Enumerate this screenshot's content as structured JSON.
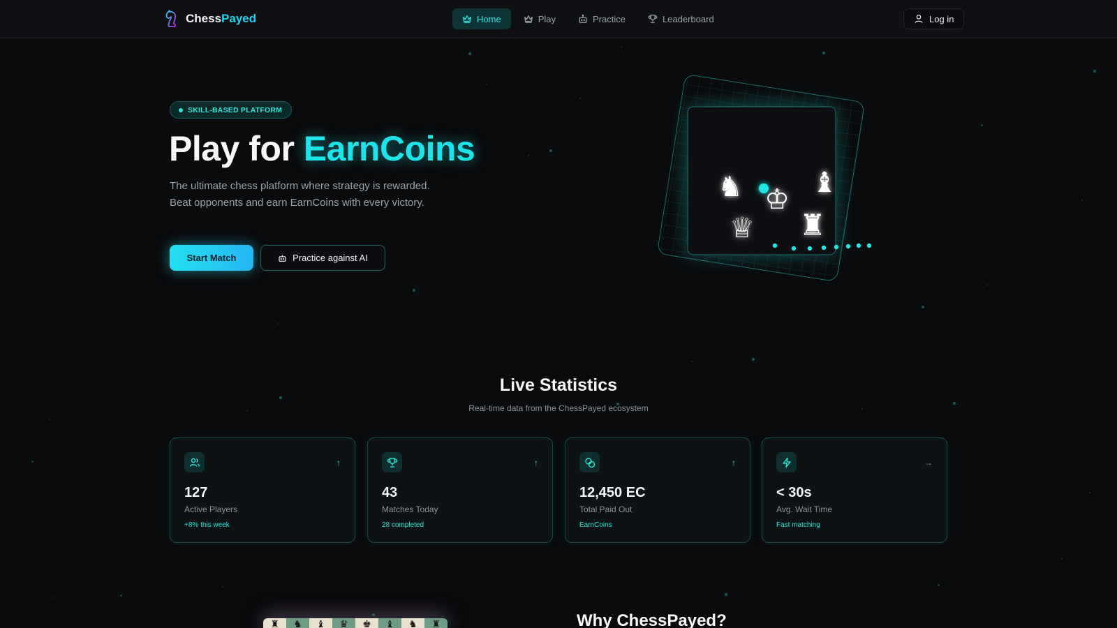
{
  "brand": {
    "name_main": "Chess",
    "name_accent": "Payed"
  },
  "nav": {
    "items": [
      {
        "label": "Home",
        "icon": "crown-icon",
        "active": true
      },
      {
        "label": "Play",
        "icon": "crown-icon",
        "active": false
      },
      {
        "label": "Practice",
        "icon": "bot-icon",
        "active": false
      },
      {
        "label": "Leaderboard",
        "icon": "trophy-icon",
        "active": false
      }
    ],
    "login_label": "Log in"
  },
  "hero": {
    "badge": "SKILL-BASED PLATFORM",
    "title_main": "Play for ",
    "title_accent": "EarnCoins",
    "description": "The ultimate chess platform where strategy is rewarded. Beat opponents and earn EarnCoins with every victory.",
    "primary_cta": "Start Match",
    "secondary_cta": "Practice against AI",
    "pieces": {
      "knight": "♞",
      "king": "♔",
      "bishop": "♝",
      "queen": "♕",
      "rook": "♜"
    }
  },
  "stats": {
    "title": "Live Statistics",
    "subtitle": "Real-time data from the ChessPayed ecosystem",
    "cards": [
      {
        "icon": "users-icon",
        "trend": "↑",
        "value": "127",
        "label": "Active Players",
        "note": "+8% this week"
      },
      {
        "icon": "trophy-icon",
        "trend": "↑",
        "value": "43",
        "label": "Matches Today",
        "note": "28 completed"
      },
      {
        "icon": "coins-icon",
        "trend": "↑",
        "value": "12,450 EC",
        "label": "Total Paid Out",
        "note": "EarnCoins"
      },
      {
        "icon": "zap-icon",
        "trend": "→",
        "value": "< 30s",
        "label": "Avg. Wait Time",
        "note": "Fast matching"
      }
    ]
  },
  "bottom": {
    "why_title": "Why ChessPayed?",
    "mini_board_pieces": [
      "♜",
      "♞",
      "♝",
      "♛",
      "♚",
      "♝",
      "♞",
      "♜"
    ]
  },
  "colors": {
    "accent": "#22d3ee",
    "background": "#0a0b0d",
    "card_border": "#164a4a"
  }
}
